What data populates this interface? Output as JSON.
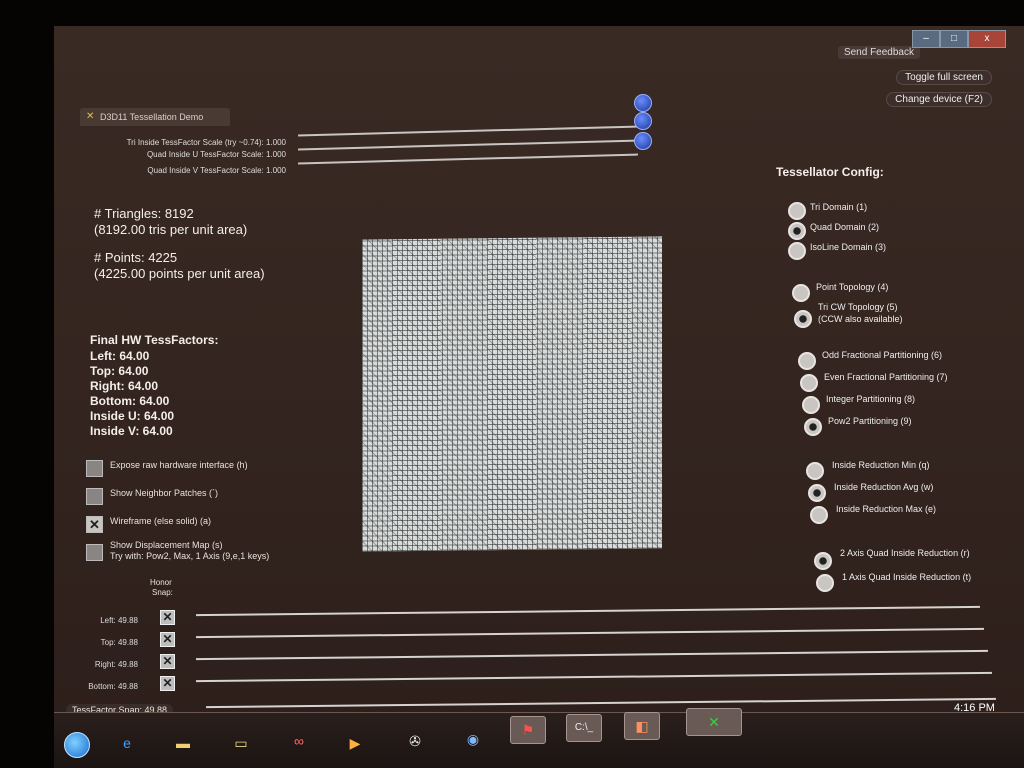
{
  "window": {
    "title": "D3D11 Tessellation Demo",
    "feedback_label": "Send Feedback",
    "controls": {
      "minimize": "–",
      "maximize": "□",
      "close": "x"
    }
  },
  "top_buttons": [
    {
      "label": "Toggle full screen"
    },
    {
      "label": "Change device (F2)"
    }
  ],
  "top_sliders": [
    {
      "label": "Tri Inside TessFactor Scale (try ~0.74): 1.000",
      "value": 1.0
    },
    {
      "label": "Quad Inside U TessFactor Scale: 1.000",
      "value": 1.0
    },
    {
      "label": "Quad Inside V TessFactor Scale: 1.000",
      "value": 1.0
    }
  ],
  "stats": {
    "triangles": "# Triangles: 8192",
    "triangles_sub": "(8192.00 tris per unit area)",
    "points": "# Points: 4225",
    "points_sub": "(4225.00 points per unit area)"
  },
  "tessfactors": {
    "heading": "Final HW TessFactors:",
    "left": "Left: 64.00",
    "top": "Top: 64.00",
    "right": "Right: 64.00",
    "bottom": "Bottom: 64.00",
    "inside_u": "Inside U: 64.00",
    "inside_v": "Inside V: 64.00"
  },
  "checkboxes": [
    {
      "label": "Expose raw hardware interface (h)",
      "checked": false
    },
    {
      "label": "Show Neighbor Patches (`)",
      "checked": false
    },
    {
      "label": "Wireframe (else solid) (a)",
      "checked": true
    },
    {
      "label": "Show Displacement Map (s)",
      "label2": "Try with: Pow2, Max, 1 Axis (9,e,1 keys)",
      "checked": false
    }
  ],
  "honor_snap_label": "Honor",
  "honor_snap_label2": "Snap:",
  "edge_sliders": [
    {
      "label": "Left: 49.88",
      "value": 49.88,
      "honor": true
    },
    {
      "label": "Top: 49.88",
      "value": 49.88,
      "honor": true
    },
    {
      "label": "Right: 49.88",
      "value": 49.88,
      "honor": true
    },
    {
      "label": "Bottom: 49.88",
      "value": 49.88,
      "honor": true
    }
  ],
  "tessfactor_snap": "TessFactor Snap: 49.88",
  "config": {
    "heading": "Tessellator Config:",
    "domain": [
      {
        "label": "Tri Domain (1)",
        "selected": false
      },
      {
        "label": "Quad Domain (2)",
        "selected": true
      },
      {
        "label": "IsoLine Domain (3)",
        "selected": false
      }
    ],
    "topology": [
      {
        "label": "Point Topology (4)",
        "selected": false
      },
      {
        "label": "Tri CW Topology (5)",
        "label2": "(CCW also available)",
        "selected": true
      }
    ],
    "partitioning": [
      {
        "label": "Odd Fractional Partitioning (6)",
        "selected": false
      },
      {
        "label": "Even Fractional Partitioning (7)",
        "selected": false
      },
      {
        "label": "Integer Partitioning (8)",
        "selected": false
      },
      {
        "label": "Pow2 Partitioning (9)",
        "selected": true
      }
    ],
    "reduction": [
      {
        "label": "Inside Reduction Min (q)",
        "selected": false
      },
      {
        "label": "Inside Reduction Avg (w)",
        "selected": true
      },
      {
        "label": "Inside Reduction Max (e)",
        "selected": false
      }
    ],
    "axis": [
      {
        "label": "2 Axis Quad Inside Reduction (r)",
        "selected": true
      },
      {
        "label": "1 Axis Quad Inside Reduction (t)",
        "selected": false
      }
    ]
  },
  "taskbar": {
    "clock": "4:16 PM",
    "apps": [
      "ie-icon",
      "folder-icon",
      "explorer-icon",
      "infinity-icon",
      "media-player-icon",
      "steam-icon",
      "network-icon",
      "pdf-icon",
      "cmd-icon",
      "paint-icon",
      "xna-icon"
    ]
  }
}
